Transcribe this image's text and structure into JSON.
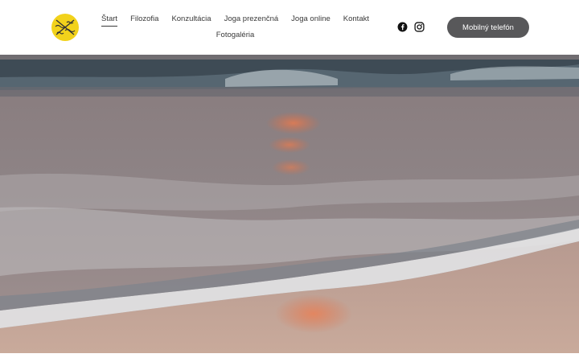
{
  "nav": {
    "items": [
      {
        "label": "Štart"
      },
      {
        "label": "Filozofia"
      },
      {
        "label": "Konzultácia"
      },
      {
        "label": "Joga prezenčná"
      },
      {
        "label": "Joga online"
      },
      {
        "label": "Kontakt"
      },
      {
        "label": "Fotogaléria"
      }
    ],
    "active": "Štart"
  },
  "header": {
    "cta_label": "Mobilný telefón",
    "social_icons": [
      "facebook-icon",
      "instagram-icon"
    ],
    "logo_icon": "sun-wave-logo-icon"
  },
  "colors": {
    "cta_background": "#58585a",
    "logo_yellow": "#f2d21b",
    "text": "#3a3a3a"
  }
}
